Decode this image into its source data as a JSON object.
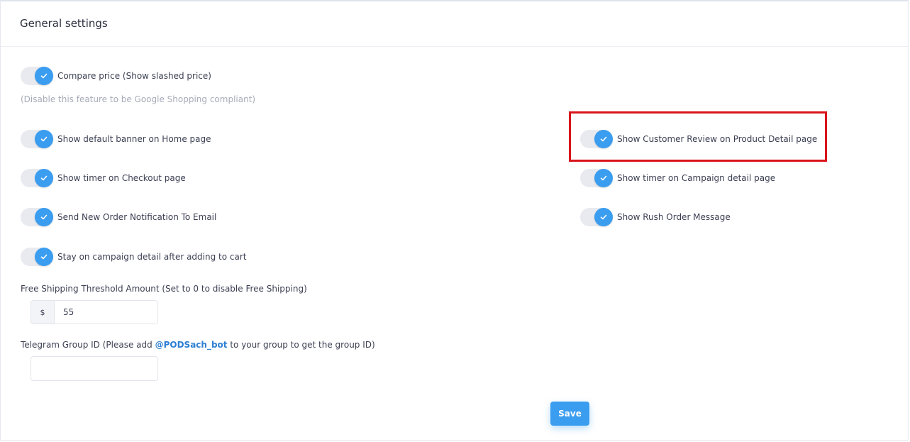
{
  "title": "General settings",
  "accent_color": "#3a9df0",
  "highlight_color": "#d9141b",
  "toggles": {
    "compare_price": {
      "label": "Compare price (Show slashed price)",
      "checked": true
    },
    "default_banner": {
      "label": "Show default banner on Home page",
      "checked": true
    },
    "customer_review": {
      "label": "Show Customer Review on Product Detail page",
      "checked": true
    },
    "timer_checkout": {
      "label": "Show timer on Checkout page",
      "checked": true
    },
    "timer_campaign": {
      "label": "Show timer on Campaign detail page",
      "checked": true
    },
    "order_notification": {
      "label": "Send New Order Notification To Email",
      "checked": true
    },
    "rush_order": {
      "label": "Show Rush Order Message",
      "checked": true
    },
    "stay_on_campaign": {
      "label": "Stay on campaign detail after adding to cart",
      "checked": true
    }
  },
  "compare_price_hint": "(Disable this feature to be Google Shopping compliant)",
  "free_shipping": {
    "label": "Free Shipping Threshold Amount (Set to 0 to disable Free Shipping)",
    "prefix": "$",
    "value": "55"
  },
  "telegram": {
    "label_before": "Telegram Group ID (Please add ",
    "mention": "@PODSach_bot",
    "label_after": " to your group to get the group ID)",
    "value": ""
  },
  "save_label": "Save"
}
